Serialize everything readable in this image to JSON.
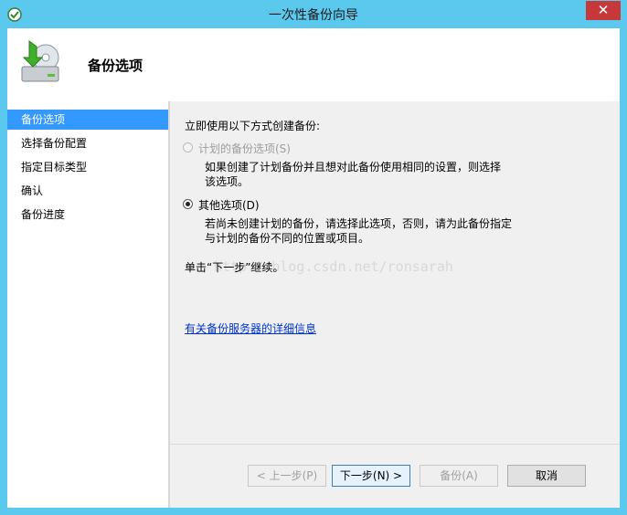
{
  "window": {
    "title": "一次性备份向导",
    "close_glyph": "✕"
  },
  "header": {
    "title": "备份选项",
    "icon": "backup-drive-icon"
  },
  "sidebar": {
    "items": [
      {
        "label": "备份选项",
        "selected": true
      },
      {
        "label": "选择备份配置",
        "selected": false
      },
      {
        "label": "指定目标类型",
        "selected": false
      },
      {
        "label": "确认",
        "selected": false
      },
      {
        "label": "备份进度",
        "selected": false
      }
    ]
  },
  "main": {
    "prompt": "立即使用以下方式创建备份:",
    "options": [
      {
        "label": "计划的备份选项(S)",
        "checked": false,
        "enabled": false,
        "description_lines": [
          "如果创建了计划备份并且想对此备份使用相同的设置，则选择",
          "该选项。"
        ]
      },
      {
        "label": "其他选项(D)",
        "checked": true,
        "enabled": true,
        "description_lines": [
          "若尚未创建计划的备份，请选择此选项，否则，请为此备份指定",
          "与计划的备份不同的位置或项目。"
        ]
      }
    ],
    "next_hint": "单击“下一步”继续。",
    "watermark": "http://blog.csdn.net/ronsarah",
    "help_link": "有关备份服务器的详细信息"
  },
  "buttons": {
    "back": "< 上一步(P)",
    "next": "下一步(N) >",
    "backup": "备份(A)",
    "cancel": "取消"
  },
  "colors": {
    "titlebar": "#5bc8ee",
    "close": "#c7383a",
    "selection": "#3399ff",
    "link": "#0033cc"
  }
}
